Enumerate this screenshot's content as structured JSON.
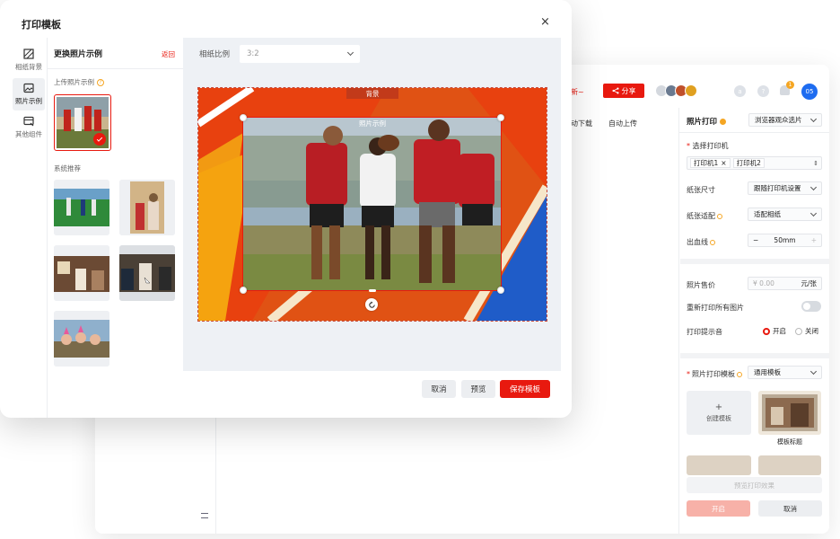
{
  "modal": {
    "title": "打印模板",
    "close_icon": "close-icon",
    "nav": [
      {
        "label": "相纸背景",
        "icon": "background-icon",
        "active": false
      },
      {
        "label": "照片示例",
        "icon": "photo-icon",
        "active": true
      },
      {
        "label": "其他组件",
        "icon": "component-icon",
        "active": false
      }
    ],
    "panel": {
      "title": "更换照片示例",
      "back_link": "返回",
      "upload_label": "上传照片示例",
      "recommend_label": "系统推荐"
    },
    "paper_ratio": {
      "label": "相纸比例",
      "value": "3:2"
    },
    "canvas": {
      "background_tag": "背景",
      "photo_tag": "照片示例"
    },
    "footer": {
      "cancel": "取消",
      "preview": "预览",
      "save": "保存模板"
    }
  },
  "background_window": {
    "notice_tail": "新~",
    "share_button": "分享",
    "notification_count": "1",
    "user_avatar": "05",
    "toolbar_items": [
      "动下载",
      "自动上传"
    ],
    "right_panel": {
      "header": {
        "title": "照片打印",
        "mode_select": "浏览器观众选片"
      },
      "printer": {
        "label": "选择打印机",
        "tags": [
          "打印机1",
          "打印机2"
        ]
      },
      "paper_size": {
        "label": "纸张尺寸",
        "value": "跟随打印机设置"
      },
      "paper_fit": {
        "label": "纸张适配",
        "value": "适配相纸"
      },
      "bleed": {
        "label": "出血线",
        "value": "50mm",
        "minus": "−",
        "plus": "+"
      },
      "price": {
        "label": "照片售价",
        "currency": "¥",
        "placeholder": "0.00",
        "unit": "元/张"
      },
      "reprint_all": {
        "label": "重新打印所有图片",
        "enabled": false
      },
      "sound": {
        "label": "打印提示音",
        "on": "开启",
        "off": "关闭",
        "selected": "开启"
      },
      "template": {
        "label": "照片打印模板",
        "value": "通用模板",
        "create_label": "创建模板",
        "default_name": "模板标题"
      },
      "preview_button": "预览打印效果",
      "start_button": "开启",
      "cancel_button": "取消"
    }
  },
  "colors": {
    "accent": "#e8190f",
    "blue": "#1e6cf0",
    "canvas_bg": "#eef1f5"
  }
}
